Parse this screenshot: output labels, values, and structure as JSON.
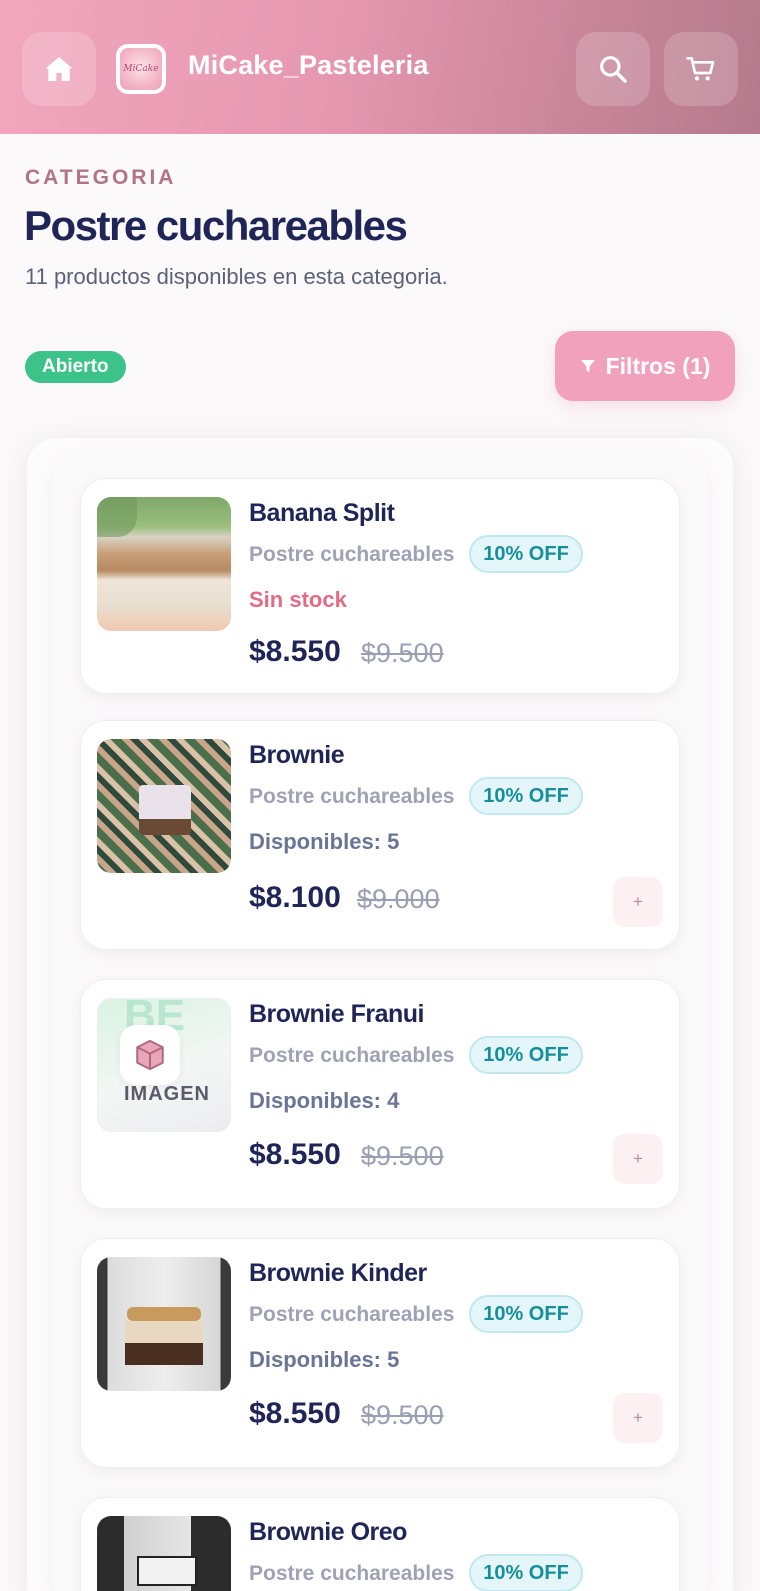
{
  "header": {
    "app_title": "MiCake_Pasteleria",
    "logo_text": "MiCake",
    "icons": [
      "home-icon",
      "search-icon",
      "cart-icon"
    ]
  },
  "category": {
    "label": "CATEGORIA",
    "title": "Postre cuchareables",
    "subtitle": "11 productos disponibles en esta categoria.",
    "status": "Abierto",
    "filter_button": "Filtros (1)"
  },
  "colors": {
    "header_gradient_start": "#f2a7be",
    "header_gradient_end": "#b57a8d",
    "accent_pink": "#f2a1bd",
    "status_green": "#3cc38a",
    "out_of_stock": "#e36b86",
    "discount_teal": "#168f9b"
  },
  "products": [
    {
      "name": "Banana Split",
      "category": "Postre cuchareables",
      "discount": "10% OFF",
      "stock": "Sin stock",
      "price": "$8.550",
      "old_price": "$9.500",
      "has_add": false
    },
    {
      "name": "Brownie",
      "category": "Postre cuchareables",
      "discount": "10% OFF",
      "stock": "Disponibles: 5",
      "price": "$8.100",
      "old_price": "$9.000",
      "has_add": true,
      "add_label": "+"
    },
    {
      "name": "Brownie Franui",
      "category": "Postre cuchareables",
      "discount": "10% OFF",
      "stock": "Disponibles: 4",
      "price": "$8.550",
      "old_price": "$9.500",
      "has_add": true,
      "add_label": "+",
      "image_placeholder": "IMAGEN",
      "image_bg_text": "BE"
    },
    {
      "name": "Brownie Kinder",
      "category": "Postre cuchareables",
      "discount": "10% OFF",
      "stock": "Disponibles: 5",
      "price": "$8.550",
      "old_price": "$9.500",
      "has_add": true,
      "add_label": "+"
    },
    {
      "name": "Brownie Oreo",
      "category": "Postre cuchareables",
      "discount": "10% OFF"
    }
  ]
}
